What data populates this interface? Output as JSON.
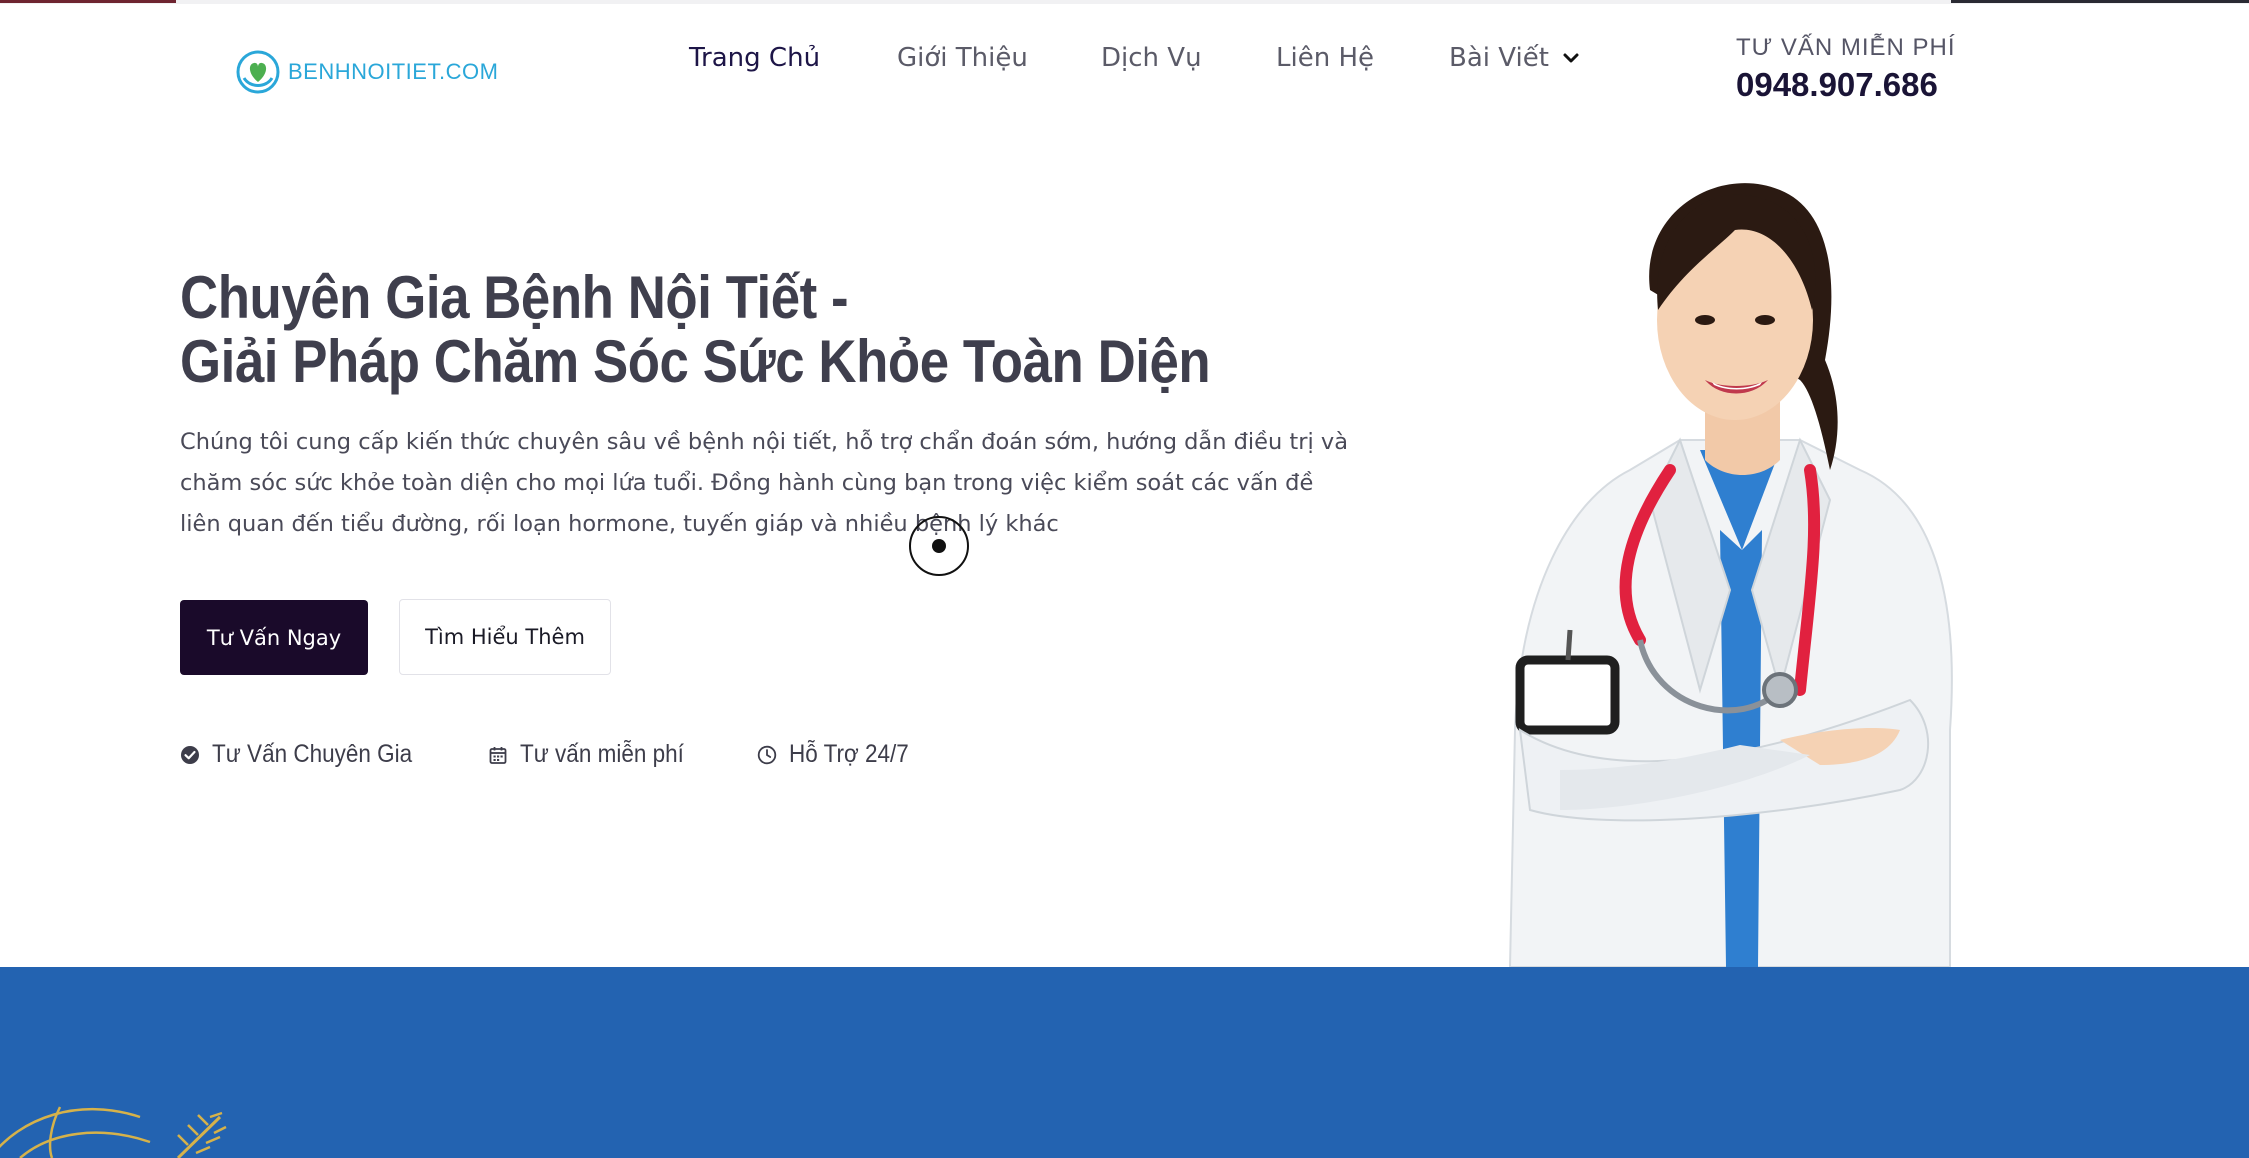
{
  "header": {
    "logo_text": "BENHNOITIET.COM",
    "nav": [
      {
        "label": "Trang Chủ",
        "active": true
      },
      {
        "label": "Giới Thiệu",
        "active": false
      },
      {
        "label": "Dịch Vụ",
        "active": false
      },
      {
        "label": "Liên Hệ",
        "active": false
      },
      {
        "label": "Bài Viết",
        "active": false,
        "has_dropdown": true
      }
    ],
    "hotline_label": "TƯ VẤN MIỄN PHÍ",
    "hotline_number": "0948.907.686"
  },
  "hero": {
    "title_line1": "Chuyên Gia Bệnh Nội Tiết -",
    "title_line2": "Giải Pháp Chăm Sóc Sức Khỏe Toàn Diện",
    "description": "Chúng tôi cung cấp kiến thức chuyên sâu về bệnh nội tiết, hỗ trợ chẩn đoán sớm, hướng dẫn điều trị và chăm sóc sức khỏe toàn diện cho mọi lứa tuổi. Đồng hành cùng bạn trong việc kiểm soát các vấn đề liên quan đến tiểu đường, rối loạn hormone, tuyến giáp và nhiều bệnh lý khác",
    "primary_button": "Tư Vấn Ngay",
    "secondary_button": "Tìm Hiểu Thêm",
    "features": [
      {
        "icon": "check-circle-icon",
        "label": "Tư Vấn Chuyên Gia"
      },
      {
        "icon": "calendar-icon",
        "label": "Tư vấn miễn phí"
      },
      {
        "icon": "clock-icon",
        "label": "Hỗ Trợ 24/7"
      }
    ]
  },
  "colors": {
    "primary_dark": "#1a0a2a",
    "heading": "#3f3f4d",
    "brand_blue": "#2363b1",
    "logo_teal": "#2aa7d9",
    "logo_green": "#4caf50"
  }
}
